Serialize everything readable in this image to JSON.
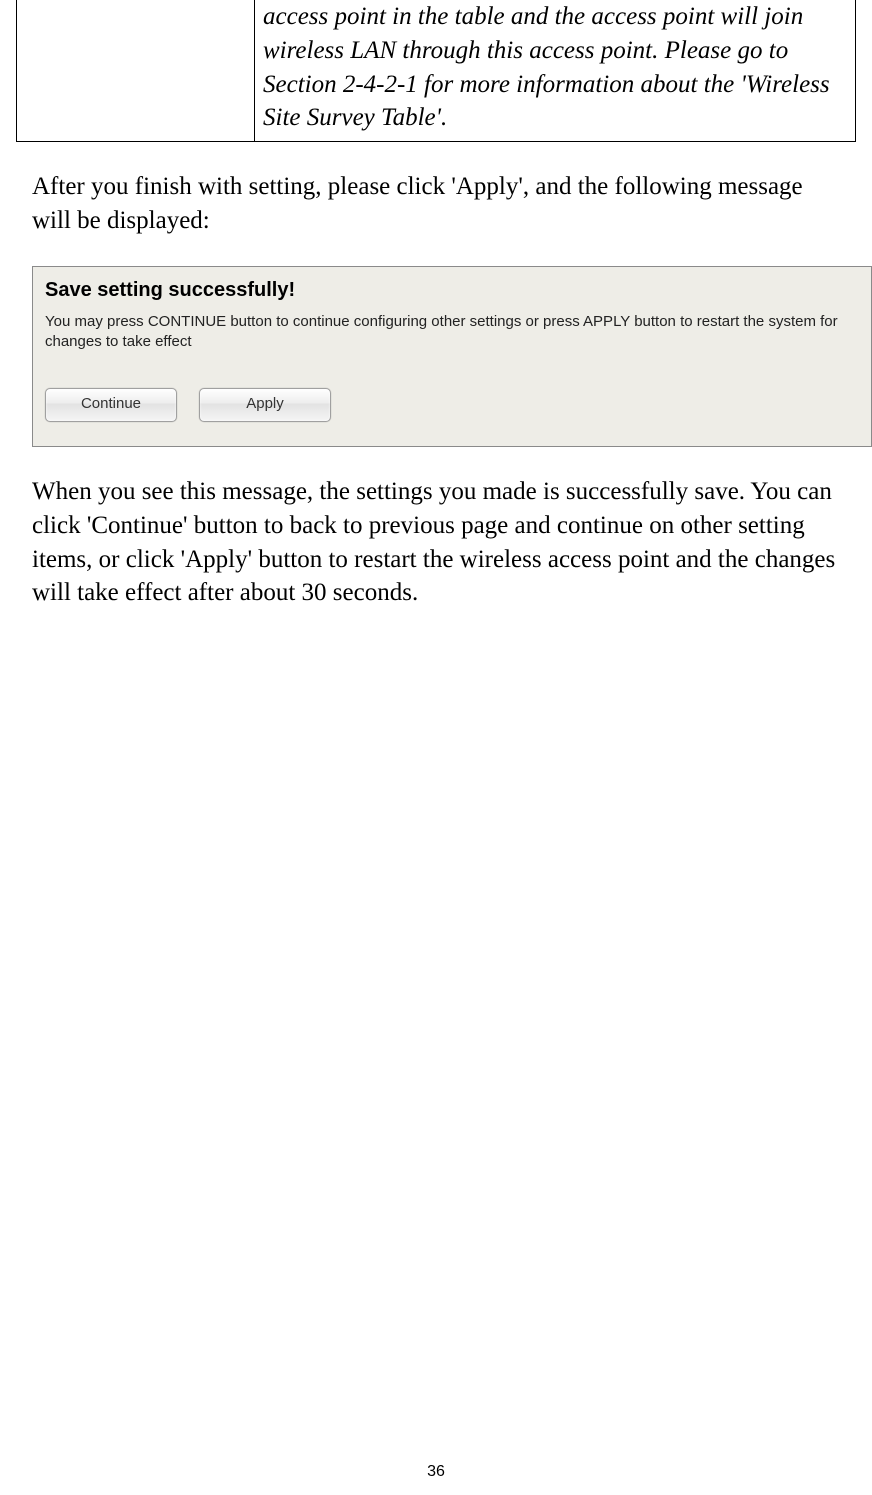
{
  "table": {
    "cell_right": "access point in the table and the access point will join wireless LAN through this access point. Please go to Section 2-4-2-1 for more information about the 'Wireless Site Survey Table'."
  },
  "para1": "After you finish with setting, please click 'Apply', and the following message will be displayed:",
  "dialog": {
    "title": "Save setting successfully!",
    "body": "You may press CONTINUE button to continue configuring other settings or press APPLY button to restart the system for changes to take effect",
    "continue_label": "Continue",
    "apply_label": "Apply"
  },
  "para2": "When you see this message, the settings you made is successfully save. You can click 'Continue' button to back to previous page and continue on other setting items, or click 'Apply' button to restart the wireless access point and the changes will take effect after about 30 seconds.",
  "page_number": "36"
}
